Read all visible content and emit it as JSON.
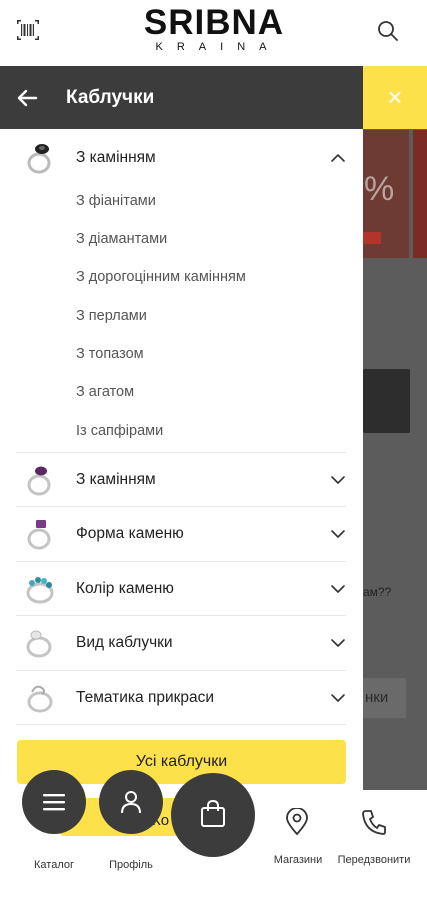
{
  "header": {
    "logo_main": "SRIBNA",
    "logo_sub": "KRAINA",
    "barcode_icon": "barcode-icon",
    "search_icon": "search-icon"
  },
  "background": {
    "promo_text": "%",
    "question_text": "ам??",
    "button_text": "нки",
    "close_symbol": "×"
  },
  "drawer": {
    "title": "Каблучки",
    "expanded_group": {
      "label": "З камінням",
      "items": [
        "З фіанітами",
        "З діамантами",
        "З дорогоцінним камінням",
        "З перлами",
        "З топазом",
        "З агатом",
        "Із сапфірами"
      ]
    },
    "groups": [
      {
        "label": "З камінням"
      },
      {
        "label": "Форма каменю"
      },
      {
        "label": "Колір каменю"
      },
      {
        "label": "Вид каблучки"
      },
      {
        "label": "Тематика прикраси"
      }
    ],
    "all_button": "Усі каблучки"
  },
  "bottom_nav": {
    "catalog": "Каталог",
    "profile": "Профіль",
    "stores": "Магазини",
    "callback": "Передзвонити",
    "peek_text": "Ко"
  },
  "colors": {
    "accent": "#fce14a",
    "dark": "#3c3c3c"
  }
}
